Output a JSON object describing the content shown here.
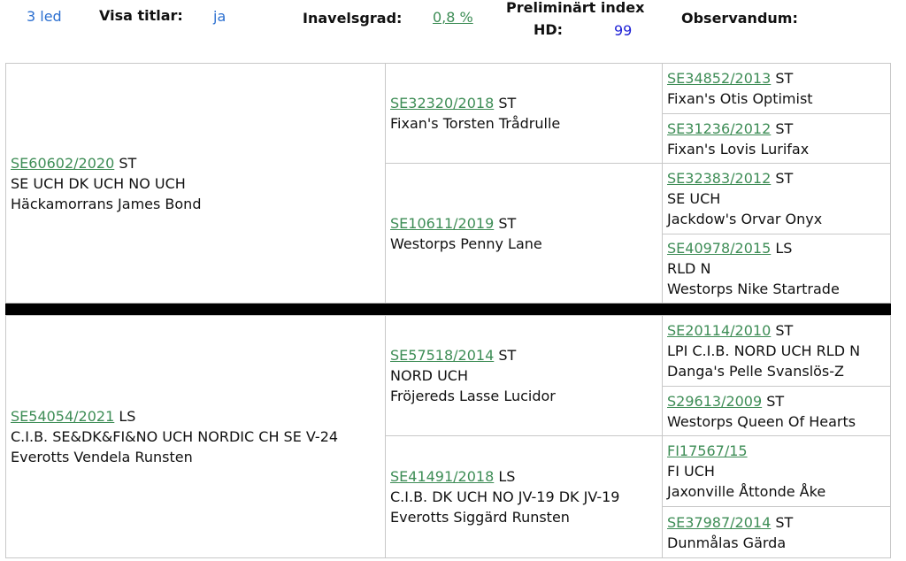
{
  "header": {
    "generations": "3 led",
    "show_titles_label": "Visa titlar:",
    "show_titles_value": "ja",
    "inbreeding_label": "Inavelsgrad:",
    "inbreeding_value": "0,8 %",
    "prelim_index_label": "Preliminärt index",
    "hd_label": "HD:",
    "hd_value": "99",
    "observandum_label": "Observandum:"
  },
  "sire": {
    "reg": "SE60602/2020",
    "status": "ST",
    "titles": "SE UCH DK UCH NO UCH",
    "name": "Häckamorrans James Bond",
    "sire": {
      "reg": "SE32320/2018",
      "status": "ST",
      "titles": "",
      "name": "Fixan's Torsten Trådrulle",
      "sire": {
        "reg": "SE34852/2013",
        "status": "ST",
        "titles": "",
        "name": "Fixan's Otis Optimist"
      },
      "dam": {
        "reg": "SE31236/2012",
        "status": "ST",
        "titles": "",
        "name": "Fixan's Lovis Lurifax"
      }
    },
    "dam": {
      "reg": "SE10611/2019",
      "status": "ST",
      "titles": "",
      "name": "Westorps Penny Lane",
      "sire": {
        "reg": "SE32383/2012",
        "status": "ST",
        "titles": "SE UCH",
        "name": "Jackdow's Orvar Onyx"
      },
      "dam": {
        "reg": "SE40978/2015",
        "status": "LS",
        "titles": "RLD N",
        "name": "Westorps Nike Startrade"
      }
    }
  },
  "dam": {
    "reg": "SE54054/2021",
    "status": "LS",
    "titles": "C.I.B. SE&DK&FI&NO UCH NORDIC CH SE V-24",
    "name": "Everotts Vendela Runsten",
    "sire": {
      "reg": "SE57518/2014",
      "status": "ST",
      "titles": "NORD UCH",
      "name": "Fröjereds Lasse Lucidor",
      "sire": {
        "reg": "SE20114/2010",
        "status": "ST",
        "titles": "LPI C.I.B. NORD UCH RLD N",
        "name": "Danga's Pelle Svanslös-Z"
      },
      "dam": {
        "reg": "S29613/2009",
        "status": "ST",
        "titles": "",
        "name": "Westorps Queen Of Hearts"
      }
    },
    "dam": {
      "reg": "SE41491/2018",
      "status": "LS",
      "titles": "C.I.B. DK UCH NO JV-19 DK JV-19",
      "name": "Everotts Siggärd Runsten",
      "sire": {
        "reg": "FI17567/15",
        "status": "",
        "titles": "FI UCH",
        "name": "Jaxonville Åttonde Åke"
      },
      "dam": {
        "reg": "SE37987/2014",
        "status": "ST",
        "titles": "",
        "name": "Dunmålas Gärda"
      }
    }
  }
}
